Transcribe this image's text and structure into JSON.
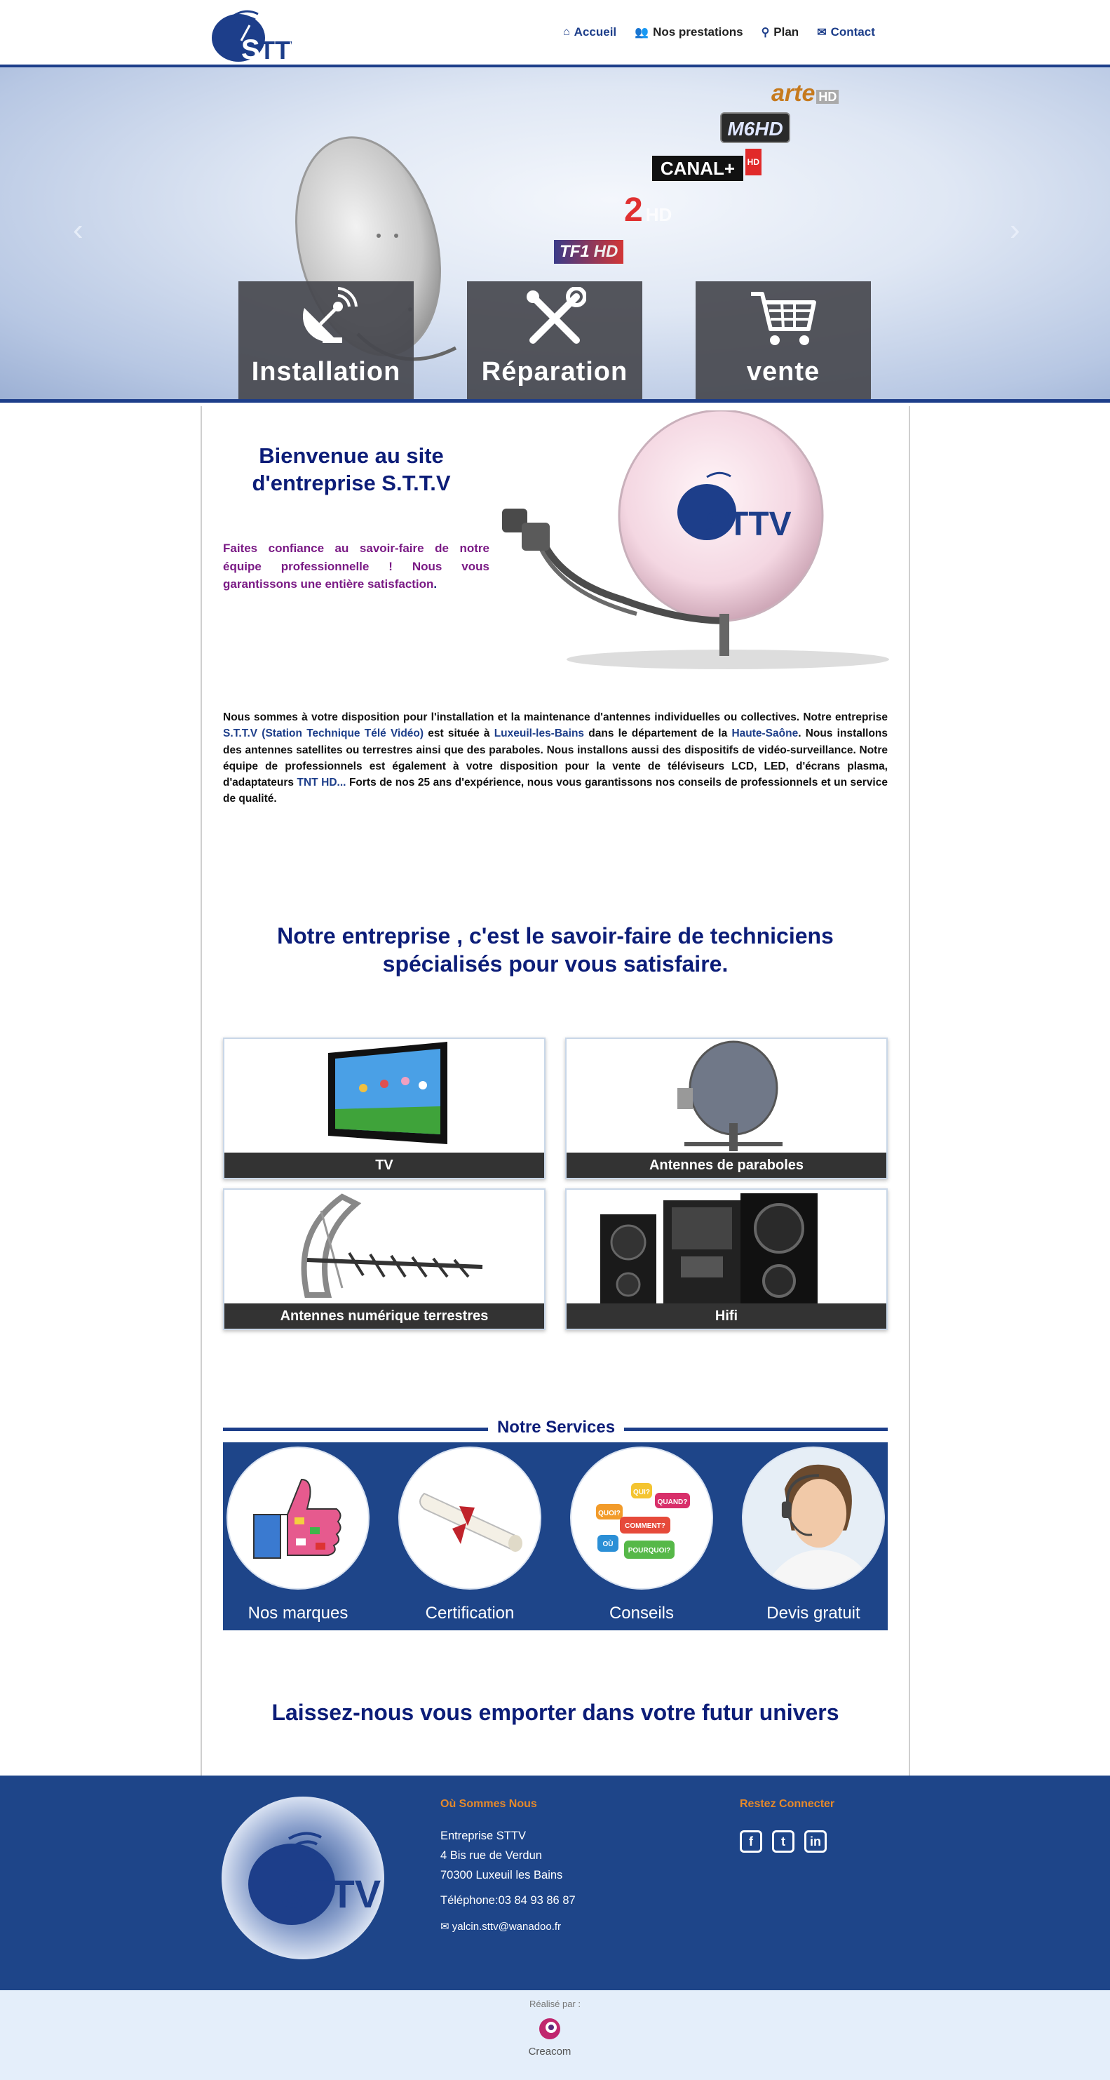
{
  "header": {
    "logo_text": "STTV",
    "nav": [
      {
        "label": "Accueil",
        "icon": "home-icon"
      },
      {
        "label": "Nos prestations",
        "icon": "users-icon"
      },
      {
        "label": "Plan",
        "icon": "map-marker-icon"
      },
      {
        "label": "Contact",
        "icon": "envelope-icon"
      }
    ]
  },
  "hero": {
    "channels": {
      "arte": "arte",
      "arte_hd": "HD",
      "m6": "M6HD",
      "canal": "CANAL+",
      "canal_hd": "HD",
      "france2": "2",
      "france2_hd": "HD",
      "tf1": "TF1",
      "tf1_hd": "HD"
    },
    "tiles": [
      {
        "label": "Installation",
        "icon": "satellite-dish-icon"
      },
      {
        "label": "Réparation",
        "icon": "tools-icon"
      },
      {
        "label": "vente",
        "icon": "shopping-cart-icon"
      }
    ],
    "prev": "‹",
    "next": "›"
  },
  "welcome": {
    "title_line1": "Bienvenue au site",
    "title_line2": "d'entreprise S.T.T.V",
    "tagline": "Faites confiance au savoir-faire de notre équipe professionnelle ! Nous vous garantissons une entière satisfaction",
    "tagline_end": ".",
    "dish_logo": "STTV"
  },
  "intro": {
    "p1": "Nous sommes à votre disposition pour l'installation et la maintenance d'antennes individuelles ou collectives. Notre entreprise ",
    "h1": "S.T.T.V (Station Technique Télé Vidéo)",
    "p2": " est située à ",
    "h2": "Luxeuil-les-Bains",
    "p3": " dans le département de la ",
    "h3": "Haute-Saône",
    "p4": ". Nous installons des antennes satellites ou terrestres ainsi que des paraboles. Nous installons aussi des dispositifs de vidéo-surveillance. Notre équipe de professionnels est également à votre disposition pour la vente de téléviseurs LCD, LED, d'écrans plasma, d'adaptateurs ",
    "h4": "TNT HD...",
    "p5": " Forts de nos 25 ans d'expérience, nous vous garantissons nos conseils de professionnels et un service de qualité."
  },
  "section_title_1_line1": "Notre entreprise , c'est le savoir-faire de techniciens",
  "section_title_1_line2": "spécialisés pour vous satisfaire.",
  "products": [
    {
      "label": "TV"
    },
    {
      "label": "Antennes de paraboles"
    },
    {
      "label": "Antennes numérique terrestres"
    },
    {
      "label": "Hifi"
    }
  ],
  "services": {
    "heading": "Notre Services",
    "items": [
      {
        "label": "Nos marques"
      },
      {
        "label": "Certification"
      },
      {
        "label": "Conseils"
      },
      {
        "label": "Devis gratuit"
      }
    ],
    "bubbles": [
      "QUOI?",
      "QUI?",
      "QUAND?",
      "COMMENT?",
      "OÙ",
      "POURQUOI?"
    ]
  },
  "section_title_3": "Laissez-nous vous emporter dans votre futur univers",
  "footer": {
    "logo_text": "STTV",
    "col1_title": "Où Sommes Nous",
    "company": "Entreprise STTV",
    "street": "4 Bis rue de Verdun",
    "city": "70300 Luxeuil les Bains",
    "phone": "Téléphone:03 84 93 86 87",
    "email": "yalcin.sttv@wanadoo.fr",
    "col2_title": "Restez Connecter",
    "social": [
      {
        "label": "f",
        "icon": "facebook-icon"
      },
      {
        "label": "t",
        "icon": "twitter-icon"
      },
      {
        "label": "in",
        "icon": "linkedin-icon"
      }
    ]
  },
  "credit": {
    "by": "Réalisé par :",
    "brand": "Creacom"
  },
  "colors": {
    "brand_blue": "#1d3e8a",
    "title_blue": "#0c1d78",
    "tagline_purple": "#7a1a85",
    "footer_orange": "#e5892a"
  }
}
